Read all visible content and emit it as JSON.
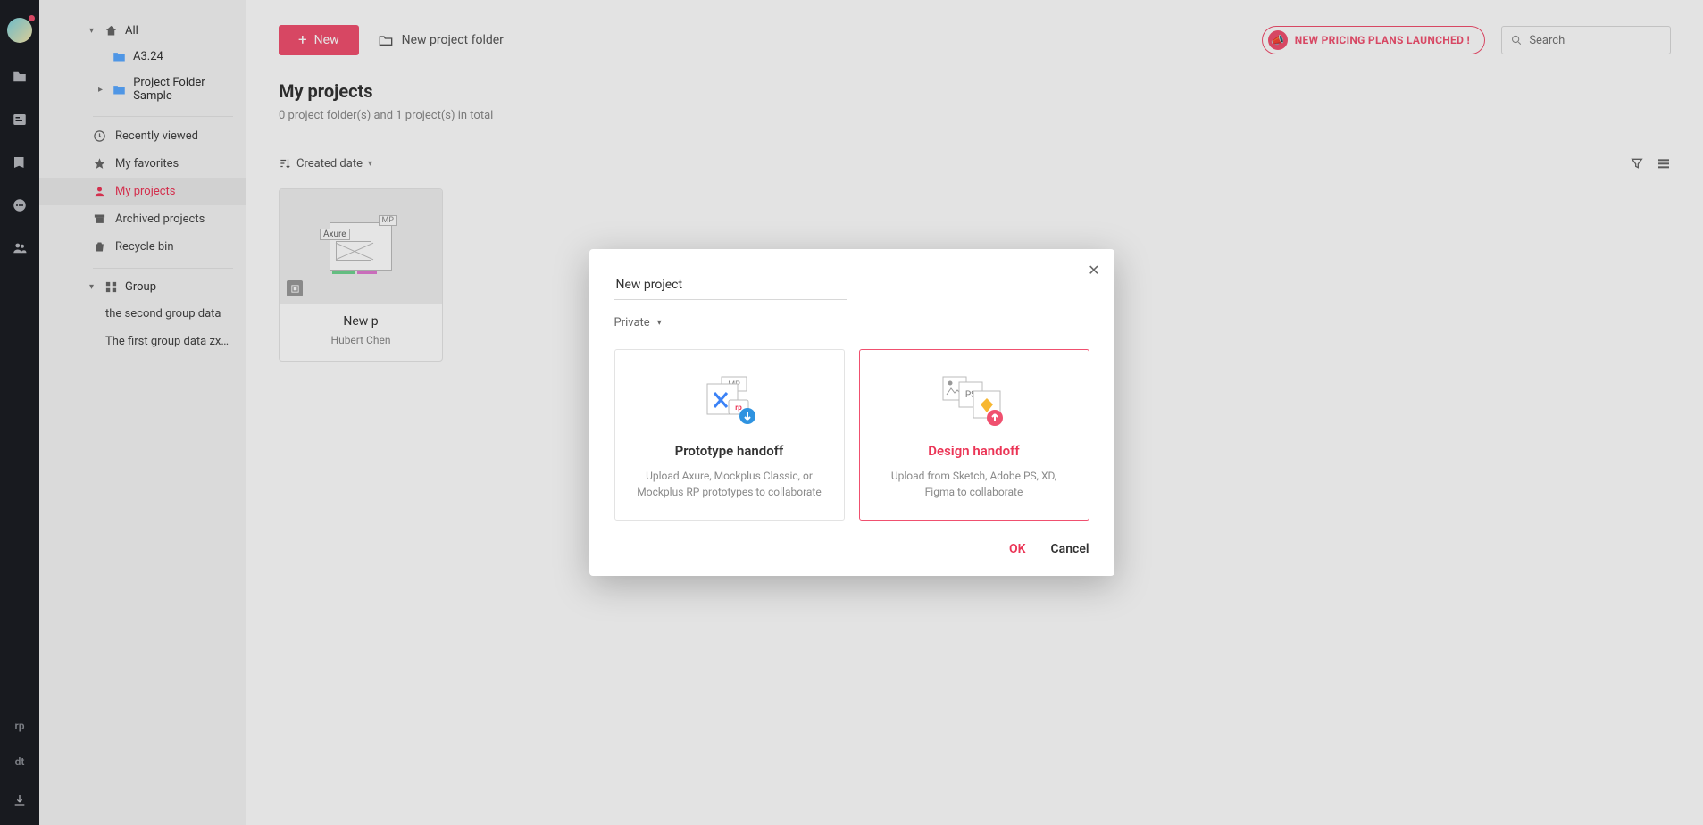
{
  "rail": {
    "bottom_labels": [
      "rp",
      "dt"
    ]
  },
  "sidebar": {
    "tree": {
      "all": "All",
      "folder_a": "A3.24",
      "folder_b": "Project Folder Sample"
    },
    "nav": {
      "recent": "Recently viewed",
      "favorites": "My favorites",
      "my_projects": "My projects",
      "archived": "Archived projects",
      "recycle": "Recycle bin"
    },
    "group": {
      "label": "Group",
      "items": [
        "the second group data",
        "The first group data zxzxcxcxbv..."
      ]
    }
  },
  "header": {
    "new_button": "New",
    "new_folder": "New project folder",
    "promo": "NEW PRICING PLANS LAUNCHED !",
    "search_placeholder": "Search"
  },
  "page": {
    "title": "My projects",
    "subtitle": "0 project folder(s) and 1 project(s) in total",
    "sort_label": "Created date"
  },
  "card": {
    "name": "New p",
    "author": "Hubert Chen",
    "wire_label": "Axure"
  },
  "modal": {
    "name_value": "New project",
    "privacy": "Private",
    "option_proto": {
      "title": "Prototype handoff",
      "desc": "Upload Axure, Mockplus Classic, or Mockplus RP prototypes to collaborate"
    },
    "option_design": {
      "title": "Design handoff",
      "desc": "Upload from Sketch, Adobe PS, XD, Figma to collaborate"
    },
    "ok": "OK",
    "cancel": "Cancel"
  }
}
